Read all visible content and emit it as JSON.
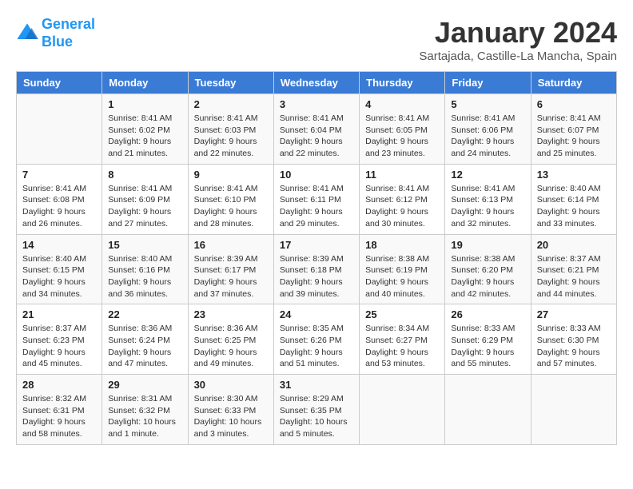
{
  "logo": {
    "line1": "General",
    "line2": "Blue"
  },
  "title": "January 2024",
  "location": "Sartajada, Castille-La Mancha, Spain",
  "days_of_week": [
    "Sunday",
    "Monday",
    "Tuesday",
    "Wednesday",
    "Thursday",
    "Friday",
    "Saturday"
  ],
  "weeks": [
    [
      {
        "day": "",
        "sunrise": "",
        "sunset": "",
        "daylight": ""
      },
      {
        "day": "1",
        "sunrise": "Sunrise: 8:41 AM",
        "sunset": "Sunset: 6:02 PM",
        "daylight": "Daylight: 9 hours and 21 minutes."
      },
      {
        "day": "2",
        "sunrise": "Sunrise: 8:41 AM",
        "sunset": "Sunset: 6:03 PM",
        "daylight": "Daylight: 9 hours and 22 minutes."
      },
      {
        "day": "3",
        "sunrise": "Sunrise: 8:41 AM",
        "sunset": "Sunset: 6:04 PM",
        "daylight": "Daylight: 9 hours and 22 minutes."
      },
      {
        "day": "4",
        "sunrise": "Sunrise: 8:41 AM",
        "sunset": "Sunset: 6:05 PM",
        "daylight": "Daylight: 9 hours and 23 minutes."
      },
      {
        "day": "5",
        "sunrise": "Sunrise: 8:41 AM",
        "sunset": "Sunset: 6:06 PM",
        "daylight": "Daylight: 9 hours and 24 minutes."
      },
      {
        "day": "6",
        "sunrise": "Sunrise: 8:41 AM",
        "sunset": "Sunset: 6:07 PM",
        "daylight": "Daylight: 9 hours and 25 minutes."
      }
    ],
    [
      {
        "day": "7",
        "sunrise": "Sunrise: 8:41 AM",
        "sunset": "Sunset: 6:08 PM",
        "daylight": "Daylight: 9 hours and 26 minutes."
      },
      {
        "day": "8",
        "sunrise": "Sunrise: 8:41 AM",
        "sunset": "Sunset: 6:09 PM",
        "daylight": "Daylight: 9 hours and 27 minutes."
      },
      {
        "day": "9",
        "sunrise": "Sunrise: 8:41 AM",
        "sunset": "Sunset: 6:10 PM",
        "daylight": "Daylight: 9 hours and 28 minutes."
      },
      {
        "day": "10",
        "sunrise": "Sunrise: 8:41 AM",
        "sunset": "Sunset: 6:11 PM",
        "daylight": "Daylight: 9 hours and 29 minutes."
      },
      {
        "day": "11",
        "sunrise": "Sunrise: 8:41 AM",
        "sunset": "Sunset: 6:12 PM",
        "daylight": "Daylight: 9 hours and 30 minutes."
      },
      {
        "day": "12",
        "sunrise": "Sunrise: 8:41 AM",
        "sunset": "Sunset: 6:13 PM",
        "daylight": "Daylight: 9 hours and 32 minutes."
      },
      {
        "day": "13",
        "sunrise": "Sunrise: 8:40 AM",
        "sunset": "Sunset: 6:14 PM",
        "daylight": "Daylight: 9 hours and 33 minutes."
      }
    ],
    [
      {
        "day": "14",
        "sunrise": "Sunrise: 8:40 AM",
        "sunset": "Sunset: 6:15 PM",
        "daylight": "Daylight: 9 hours and 34 minutes."
      },
      {
        "day": "15",
        "sunrise": "Sunrise: 8:40 AM",
        "sunset": "Sunset: 6:16 PM",
        "daylight": "Daylight: 9 hours and 36 minutes."
      },
      {
        "day": "16",
        "sunrise": "Sunrise: 8:39 AM",
        "sunset": "Sunset: 6:17 PM",
        "daylight": "Daylight: 9 hours and 37 minutes."
      },
      {
        "day": "17",
        "sunrise": "Sunrise: 8:39 AM",
        "sunset": "Sunset: 6:18 PM",
        "daylight": "Daylight: 9 hours and 39 minutes."
      },
      {
        "day": "18",
        "sunrise": "Sunrise: 8:38 AM",
        "sunset": "Sunset: 6:19 PM",
        "daylight": "Daylight: 9 hours and 40 minutes."
      },
      {
        "day": "19",
        "sunrise": "Sunrise: 8:38 AM",
        "sunset": "Sunset: 6:20 PM",
        "daylight": "Daylight: 9 hours and 42 minutes."
      },
      {
        "day": "20",
        "sunrise": "Sunrise: 8:37 AM",
        "sunset": "Sunset: 6:21 PM",
        "daylight": "Daylight: 9 hours and 44 minutes."
      }
    ],
    [
      {
        "day": "21",
        "sunrise": "Sunrise: 8:37 AM",
        "sunset": "Sunset: 6:23 PM",
        "daylight": "Daylight: 9 hours and 45 minutes."
      },
      {
        "day": "22",
        "sunrise": "Sunrise: 8:36 AM",
        "sunset": "Sunset: 6:24 PM",
        "daylight": "Daylight: 9 hours and 47 minutes."
      },
      {
        "day": "23",
        "sunrise": "Sunrise: 8:36 AM",
        "sunset": "Sunset: 6:25 PM",
        "daylight": "Daylight: 9 hours and 49 minutes."
      },
      {
        "day": "24",
        "sunrise": "Sunrise: 8:35 AM",
        "sunset": "Sunset: 6:26 PM",
        "daylight": "Daylight: 9 hours and 51 minutes."
      },
      {
        "day": "25",
        "sunrise": "Sunrise: 8:34 AM",
        "sunset": "Sunset: 6:27 PM",
        "daylight": "Daylight: 9 hours and 53 minutes."
      },
      {
        "day": "26",
        "sunrise": "Sunrise: 8:33 AM",
        "sunset": "Sunset: 6:29 PM",
        "daylight": "Daylight: 9 hours and 55 minutes."
      },
      {
        "day": "27",
        "sunrise": "Sunrise: 8:33 AM",
        "sunset": "Sunset: 6:30 PM",
        "daylight": "Daylight: 9 hours and 57 minutes."
      }
    ],
    [
      {
        "day": "28",
        "sunrise": "Sunrise: 8:32 AM",
        "sunset": "Sunset: 6:31 PM",
        "daylight": "Daylight: 9 hours and 58 minutes."
      },
      {
        "day": "29",
        "sunrise": "Sunrise: 8:31 AM",
        "sunset": "Sunset: 6:32 PM",
        "daylight": "Daylight: 10 hours and 1 minute."
      },
      {
        "day": "30",
        "sunrise": "Sunrise: 8:30 AM",
        "sunset": "Sunset: 6:33 PM",
        "daylight": "Daylight: 10 hours and 3 minutes."
      },
      {
        "day": "31",
        "sunrise": "Sunrise: 8:29 AM",
        "sunset": "Sunset: 6:35 PM",
        "daylight": "Daylight: 10 hours and 5 minutes."
      },
      {
        "day": "",
        "sunrise": "",
        "sunset": "",
        "daylight": ""
      },
      {
        "day": "",
        "sunrise": "",
        "sunset": "",
        "daylight": ""
      },
      {
        "day": "",
        "sunrise": "",
        "sunset": "",
        "daylight": ""
      }
    ]
  ]
}
